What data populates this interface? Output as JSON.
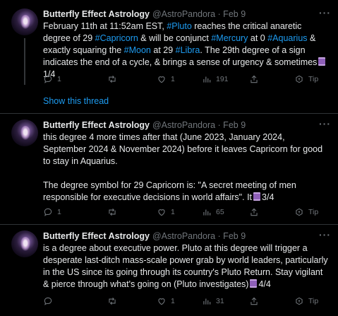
{
  "tweets": [
    {
      "name": "Butterfly Effect Astrology",
      "handle": "@AstroPandora · Feb 9",
      "more": "···",
      "body": {
        "t1": "February 11th at 11:52am EST, ",
        "h1": "#Pluto",
        "t2": " reaches the critical anaretic degree of 29 ",
        "h2": "#Capricorn",
        "t3": " & will be conjunct ",
        "h3": "#Mercury",
        "t4": " at 0 ",
        "h4": "#Aquarius",
        "t5": " & exactly squaring the ",
        "h5": "#Moon",
        "t6": " at 29 ",
        "h6": "#Libra",
        "t7": ". The 29th degree of a sign indicates the end of a cycle, & brings a sense of urgency & sometimes",
        "t8": "1/4"
      },
      "replies": "1",
      "retweets": "",
      "likes": "1",
      "views": "191",
      "tip": "Tip"
    },
    {
      "name": "Butterfly Effect Astrology",
      "handle": "@AstroPandora · Feb 9",
      "more": "···",
      "body": {
        "p1": "this degree 4 more times after that (June 2023, January 2024, September 2024 & November 2024) before it leaves Capricorn for good to stay in Aquarius.",
        "p2": "The degree symbol for 29 Capricorn is: \"A secret meeting of men responsible for executive decisions in world affairs\". It",
        "p2end": "3/4"
      },
      "replies": "1",
      "retweets": "",
      "likes": "1",
      "views": "65",
      "tip": "Tip"
    },
    {
      "name": "Butterfly Effect Astrology",
      "handle": "@AstroPandora · Feb 9",
      "more": "···",
      "body": {
        "p1": "is a degree about executive power. Pluto at this degree will trigger a desperate last-ditch mass-scale power grab by world leaders, particularly in the US since its going through its country's Pluto Return. Stay vigilant & pierce through what's going on (Pluto investigates)",
        "p1end": "4/4"
      },
      "replies": "",
      "retweets": "",
      "likes": "1",
      "views": "31",
      "tip": "Tip"
    }
  ],
  "show_thread": "Show this thread"
}
